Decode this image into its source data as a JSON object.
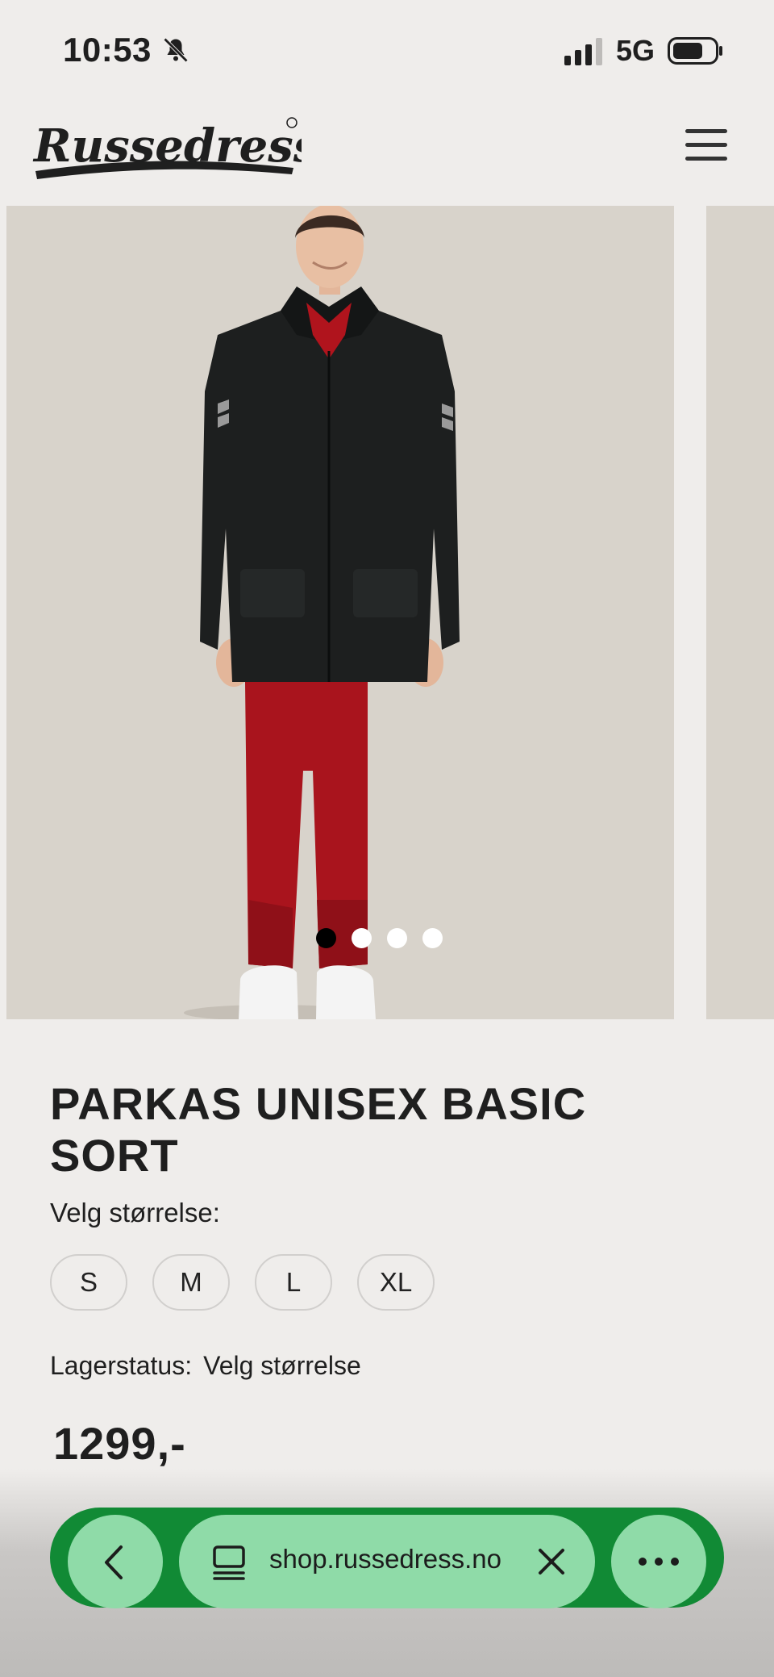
{
  "status_bar": {
    "time": "10:53",
    "network": "5G",
    "icons": [
      "bell-muted-icon",
      "signal-icon",
      "battery-icon"
    ]
  },
  "header": {
    "brand": "Russedress",
    "menu_icon": "hamburger-menu-icon"
  },
  "gallery": {
    "slide_count": 4,
    "active_index": 0
  },
  "product": {
    "title": "PARKAS UNISEX BASIC SORT",
    "size_label": "Velg størrelse:",
    "sizes": [
      "S",
      "M",
      "L",
      "XL"
    ],
    "stock_label": "Lagerstatus:",
    "stock_value": "Velg størrelse",
    "price": "1299,-"
  },
  "browser": {
    "url": "shop.russedress.no",
    "icons": [
      "chevron-left-icon",
      "tabs-icon",
      "close-icon",
      "more-icon"
    ]
  },
  "colors": {
    "background": "#efedeb",
    "photo_bg": "#d8d3cb",
    "browser_bar": "#118a35",
    "browser_buttons": "#8fdba8"
  }
}
